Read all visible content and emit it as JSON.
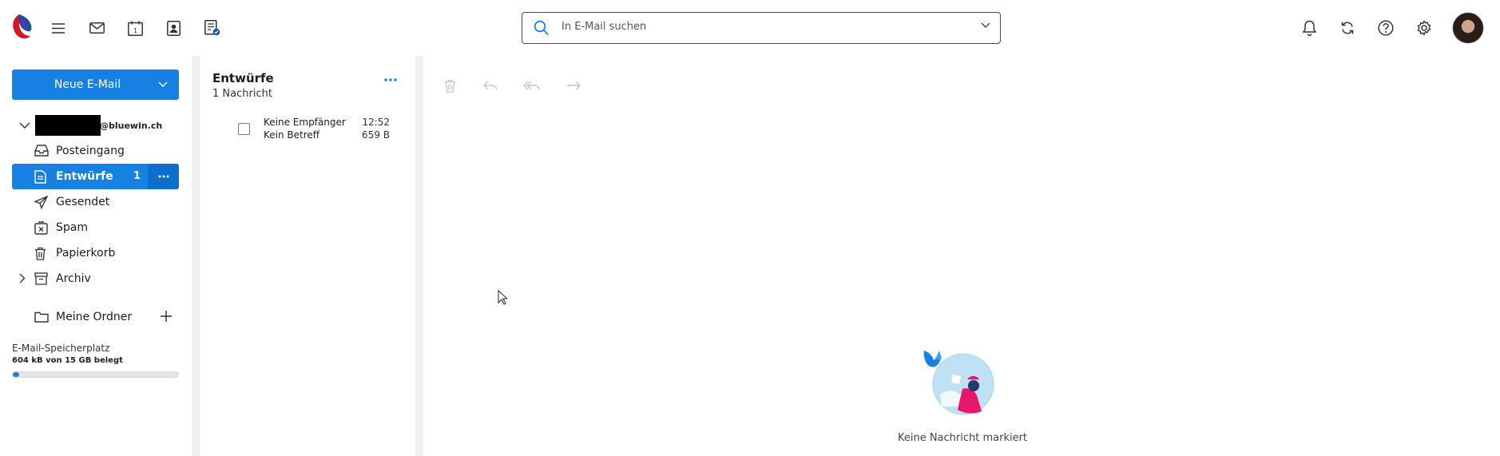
{
  "header": {
    "icons": [
      "swisscom-logo",
      "menu-icon",
      "mail-icon",
      "calendar-icon",
      "contacts-icon",
      "notes-icon"
    ],
    "calendar_day": "1",
    "search": {
      "placeholder": "In E-Mail suchen"
    },
    "right_icons": [
      "bell-icon",
      "refresh-icon",
      "help-icon",
      "settings-icon",
      "avatar"
    ]
  },
  "sidebar": {
    "new_mail_label": "Neue E-Mail",
    "account_domain": "@bluewin.ch",
    "folders": [
      {
        "label": "Posteingang",
        "icon": "inbox-icon"
      },
      {
        "label": "Entwürfe",
        "icon": "draft-icon",
        "count": "1",
        "active": true
      },
      {
        "label": "Gesendet",
        "icon": "send-icon"
      },
      {
        "label": "Spam",
        "icon": "spam-icon"
      },
      {
        "label": "Papierkorb",
        "icon": "trash-icon"
      },
      {
        "label": "Archiv",
        "icon": "archive-icon"
      }
    ],
    "my_folders_label": "Meine Ordner",
    "storage": {
      "label": "E-Mail-Speicherplatz",
      "value": "604 kB von 15 GB belegt",
      "fill_percent": 4
    }
  },
  "message_list": {
    "title": "Entwürfe",
    "subtitle": "1 Nachricht",
    "messages": [
      {
        "from": "Keine Empfänger",
        "subject": "Kein Betreff",
        "time": "12:52",
        "size": "659 B"
      }
    ]
  },
  "reading_pane": {
    "toolbar": [
      "delete-icon",
      "reply-icon",
      "reply-all-icon",
      "forward-icon"
    ],
    "empty_text": "Keine Nachricht markiert"
  },
  "colors": {
    "accent": "#1781e3",
    "accent_dark": "#0d6fcd"
  }
}
